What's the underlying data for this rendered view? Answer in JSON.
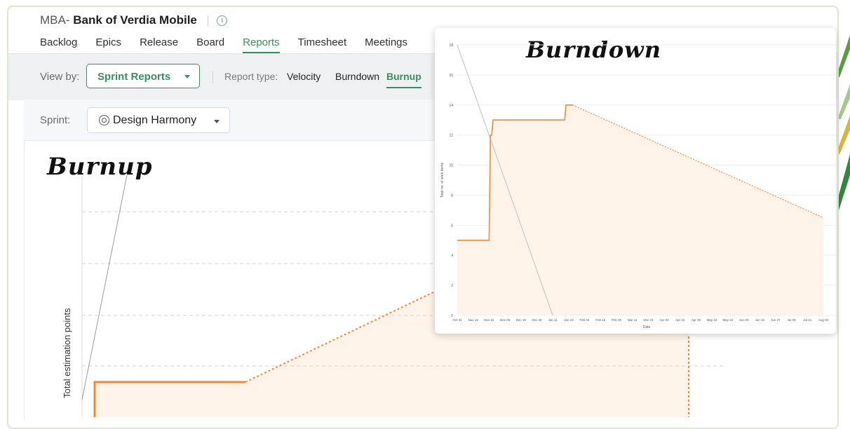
{
  "project": {
    "prefix": "MBA-",
    "name": "Bank of Verdia Mobile",
    "info_icon": "info-circle-icon"
  },
  "tabs": [
    {
      "label": "Backlog",
      "active": false
    },
    {
      "label": "Epics",
      "active": false
    },
    {
      "label": "Release",
      "active": false
    },
    {
      "label": "Board",
      "active": false
    },
    {
      "label": "Reports",
      "active": true
    },
    {
      "label": "Timesheet",
      "active": false
    },
    {
      "label": "Meetings",
      "active": false
    }
  ],
  "toolbar": {
    "view_by_label": "View by:",
    "view_by_value": "Sprint Reports",
    "report_type_label": "Report type:",
    "report_types": [
      {
        "label": "Velocity",
        "active": false
      },
      {
        "label": "Burndown",
        "active": false
      },
      {
        "label": "Burnup",
        "active": true
      }
    ]
  },
  "sprint": {
    "label": "Sprint:",
    "value": "Design Harmony",
    "icon": "sprint-icon"
  },
  "colors": {
    "accent": "#3a8e5c",
    "series": "#f08a3a",
    "area": "#fdf3e9"
  },
  "burnup": {
    "title": "Burnup",
    "ylabel": "Total estimation points"
  },
  "burndown": {
    "title": "Burndown"
  },
  "chart_data": [
    {
      "type": "line",
      "title": "Burnup",
      "ylabel": "Total estimation points",
      "xlabel": "",
      "grid": true,
      "series": [
        {
          "values": [
            0,
            1,
            1,
            1,
            2,
            3,
            4
          ]
        }
      ]
    },
    {
      "type": "line",
      "title": "Burndown",
      "xlabel": "Date",
      "ylabel": "Total no. of work Items",
      "ylim": [
        0,
        18
      ],
      "yticks": [
        0,
        2,
        4,
        6,
        8,
        10,
        12,
        14,
        16,
        18
      ],
      "xticks": [
        "Oct 31",
        "Nov 12",
        "Nov 24",
        "Dec 06",
        "Dec 18",
        "Dec 30",
        "Jan 11",
        "Jan 23",
        "Feb 04",
        "Feb 16",
        "Feb 28",
        "Mar 11",
        "Mar 23",
        "Apr 04",
        "Apr 16",
        "Apr 28",
        "May 10",
        "May 22",
        "Jun 03",
        "Jun 15",
        "Jun 27",
        "Jul 09",
        "Jul 21",
        "Aug 02"
      ],
      "grid": true,
      "series": [
        {
          "style": "ideal",
          "x": [
            "Oct 31",
            "Jan 11"
          ],
          "y": [
            18,
            0
          ]
        },
        {
          "style": "actual",
          "x": [
            "Oct 31",
            "Nov 24",
            "Nov 25",
            "Nov 26",
            "Nov 27",
            "Jan 20",
            "Jan 21",
            "Jan 26"
          ],
          "y": [
            5,
            5,
            12,
            12,
            13,
            13,
            14,
            14
          ]
        },
        {
          "style": "projected",
          "x": [
            "Jan 26",
            "Aug 02"
          ],
          "y": [
            14,
            6.5
          ]
        }
      ]
    }
  ]
}
